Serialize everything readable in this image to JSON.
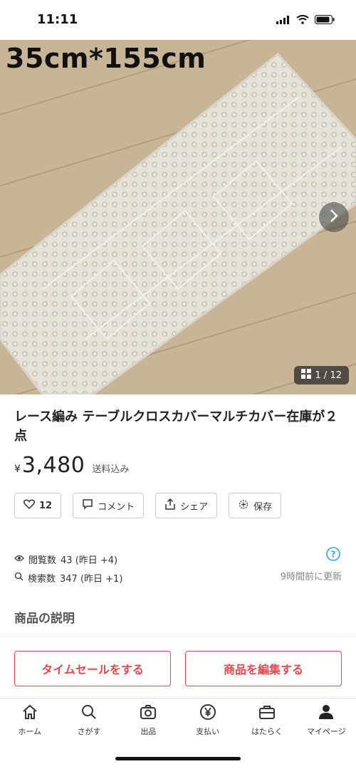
{
  "status_bar": {
    "time": "11:11"
  },
  "hero": {
    "caption": "35cm*155cm",
    "counter": "1 / 12"
  },
  "product": {
    "title": "レース編み テーブルクロスカバーマルチカバー在庫が２点",
    "price_symbol": "¥",
    "price": "3,480",
    "price_note": "送料込み"
  },
  "actions": {
    "like_count": "12",
    "comment": "コメント",
    "share": "シェア",
    "save": "保存"
  },
  "stats": {
    "views_label": "閲覧数",
    "views_value": "43 (昨日 +4)",
    "search_label": "検索数",
    "search_value": "347 (昨日 +1)",
    "updated": "9時間前に更新"
  },
  "description": {
    "title": "商品の説明"
  },
  "cta": {
    "timesale": "タイムセールをする",
    "edit": "商品を編集する"
  },
  "tabs": [
    {
      "label": "ホーム",
      "icon": "home-icon"
    },
    {
      "label": "さがす",
      "icon": "search-icon"
    },
    {
      "label": "出品",
      "icon": "camera-icon"
    },
    {
      "label": "支払い",
      "icon": "yen-icon"
    },
    {
      "label": "はたらく",
      "icon": "briefcase-icon"
    },
    {
      "label": "マイページ",
      "icon": "person-icon"
    }
  ],
  "colors": {
    "accent": "#e8484b",
    "help": "#3aa3d8",
    "floor": "#c9b79d",
    "lace": "#e9e6df"
  }
}
